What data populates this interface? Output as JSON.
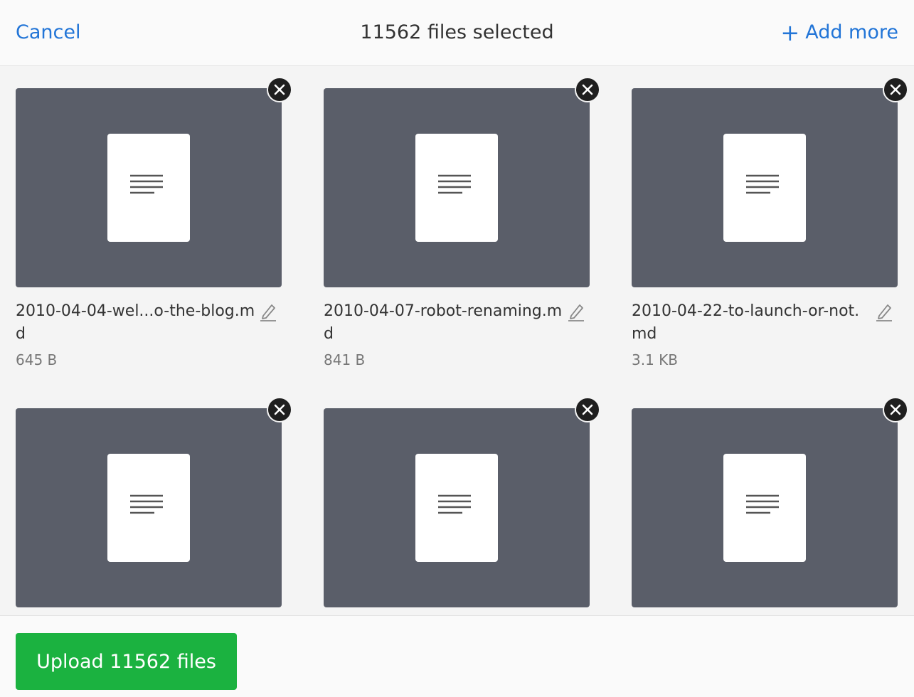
{
  "header": {
    "cancel_label": "Cancel",
    "title": "11562 files selected",
    "add_more_label": "Add more",
    "add_more_icon": "plus-icon"
  },
  "files": [
    {
      "name": "2010-04-04-wel...o-the-blog.md",
      "size": "645 B"
    },
    {
      "name": "2010-04-07-robot-renaming.md",
      "size": "841 B"
    },
    {
      "name": "2010-04-22-to-launch-or-not.md",
      "size": "3.1 KB"
    },
    {
      "name": "",
      "size": ""
    },
    {
      "name": "",
      "size": ""
    },
    {
      "name": "",
      "size": ""
    }
  ],
  "footer": {
    "upload_label": "Upload 11562 files"
  },
  "colors": {
    "accent_blue": "#2275d7",
    "upload_green": "#1bb240",
    "thumbnail_bg": "#5a5e69"
  }
}
